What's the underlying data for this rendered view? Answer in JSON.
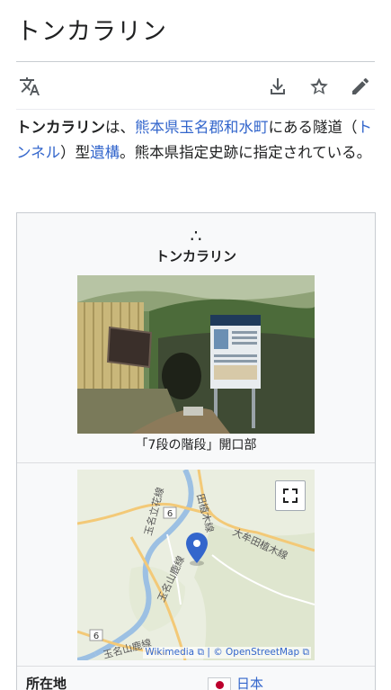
{
  "page": {
    "title": "トンカラリン"
  },
  "toolbar": {
    "language_icon": "translate-icon",
    "download_icon": "download-icon",
    "watch_icon": "star-icon",
    "edit_icon": "pencil-icon"
  },
  "lead": {
    "bold_term": "トンカラリン",
    "t1": "は、",
    "link1": "熊本県",
    "link2": "玉名郡",
    "link3": "和水町",
    "t2": "にある隧道（",
    "link4": "トンネル",
    "t3": "）型",
    "link5": "遺構",
    "t4": "。熊本県指定史跡に指定されている。"
  },
  "infobox": {
    "symbol": "∴",
    "title": "トンカラリン",
    "photo_caption": "「7段の階段」開口部",
    "map_labels": {
      "route6_top": "6",
      "route6_bottom": "6",
      "rail1": "田植木線",
      "rail2": "大牟田植木線",
      "rail3": "玉名立花線",
      "rail4": "玉名山鹿線",
      "rail5": "玉名山鹿線"
    },
    "map_credit_1": "Wikimedia",
    "map_credit_sep": "|",
    "map_credit_2": "© OpenStreetMap",
    "location_label": "所在地",
    "location_value": "日本"
  },
  "colors": {
    "link": "#3366cc",
    "text": "#202122",
    "pin": "#3366cc"
  }
}
